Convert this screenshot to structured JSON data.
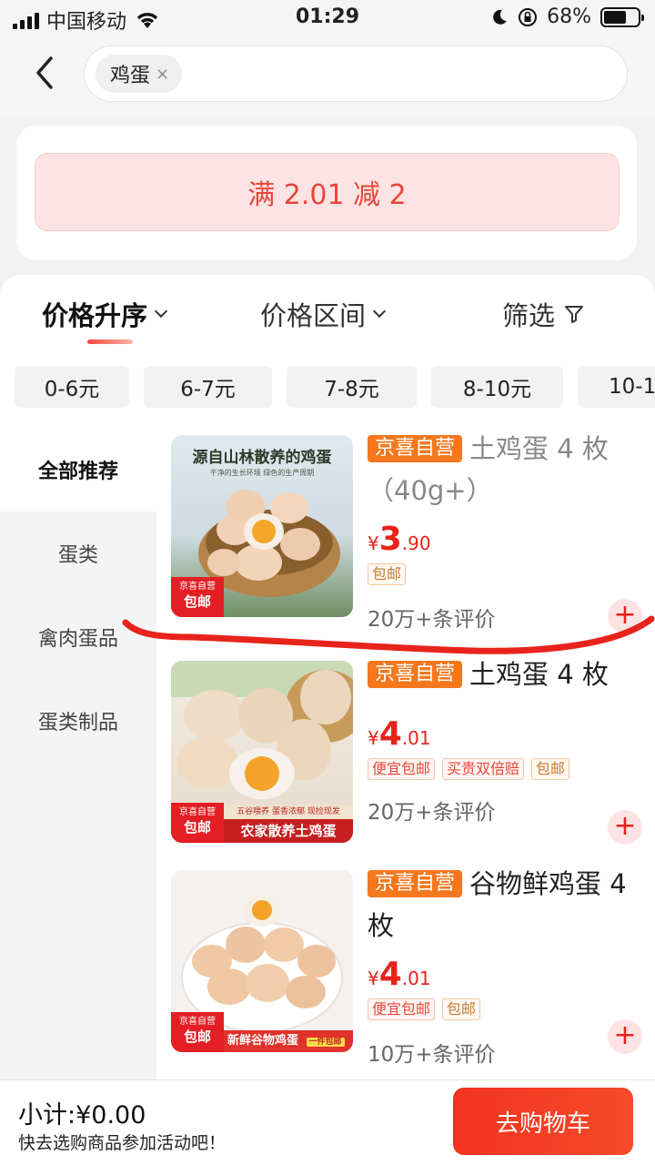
{
  "status_bar": {
    "carrier": "中国移动",
    "time": "01:29",
    "battery": "68%",
    "battery_level": 0.68
  },
  "search": {
    "chip_label": "鸡蛋",
    "chip_close": "×"
  },
  "promo": {
    "text": "满 2.01 减 2"
  },
  "sort": {
    "price_asc": "价格升序",
    "price_range": "价格区间",
    "filter": "筛选"
  },
  "ranges": [
    "0-6元",
    "6-7元",
    "7-8元",
    "8-10元",
    "10-1"
  ],
  "sidenav": [
    "全部推荐",
    "蛋类",
    "禽肉蛋品",
    "蛋类制品"
  ],
  "products": [
    {
      "self_badge": "京喜自营",
      "title": "土鸡蛋 4 枚（40g+）",
      "price_symbol": "¥",
      "price_int": "3",
      "price_dec": ".90",
      "tags": [
        "包邮"
      ],
      "reviews": "20万+条评价",
      "image_caption": "源自山林散养的鸡蛋",
      "image_subcaption": "干净的生长环境 绿色的生产周期",
      "image_badge_top": "京喜自营",
      "image_badge_bottom": "包邮"
    },
    {
      "self_badge": "京喜自营",
      "title": "土鸡蛋 4 枚",
      "price_symbol": "¥",
      "price_int": "4",
      "price_dec": ".01",
      "tags": [
        "便宜包邮",
        "买贵双倍赔",
        "包邮"
      ],
      "reviews": "20万+条评价",
      "image_caption": "农家散养土鸡蛋",
      "image_subcaption": "五谷喂养 蛋香浓郁 现捡现发",
      "image_badge_top": "京喜自营",
      "image_badge_bottom": "包邮"
    },
    {
      "self_badge": "京喜自营",
      "title": "谷物鲜鸡蛋 4 枚",
      "price_symbol": "¥",
      "price_int": "4",
      "price_dec": ".01",
      "tags": [
        "便宜包邮",
        "包邮"
      ],
      "reviews": "10万+条评价",
      "image_caption": "新鲜谷物鸡蛋",
      "image_subcaption": "一件包邮",
      "image_badge_top": "京喜自营",
      "image_badge_bottom": "包邮"
    }
  ],
  "bottom": {
    "subtotal": "小计:¥0.00",
    "hint": "快去选购商品参加活动吧！",
    "cart_button": "去购物车"
  },
  "colors": {
    "accent": "#e8231b",
    "promo_bg": "#fde3e3",
    "self_badge": "#f5781e"
  }
}
